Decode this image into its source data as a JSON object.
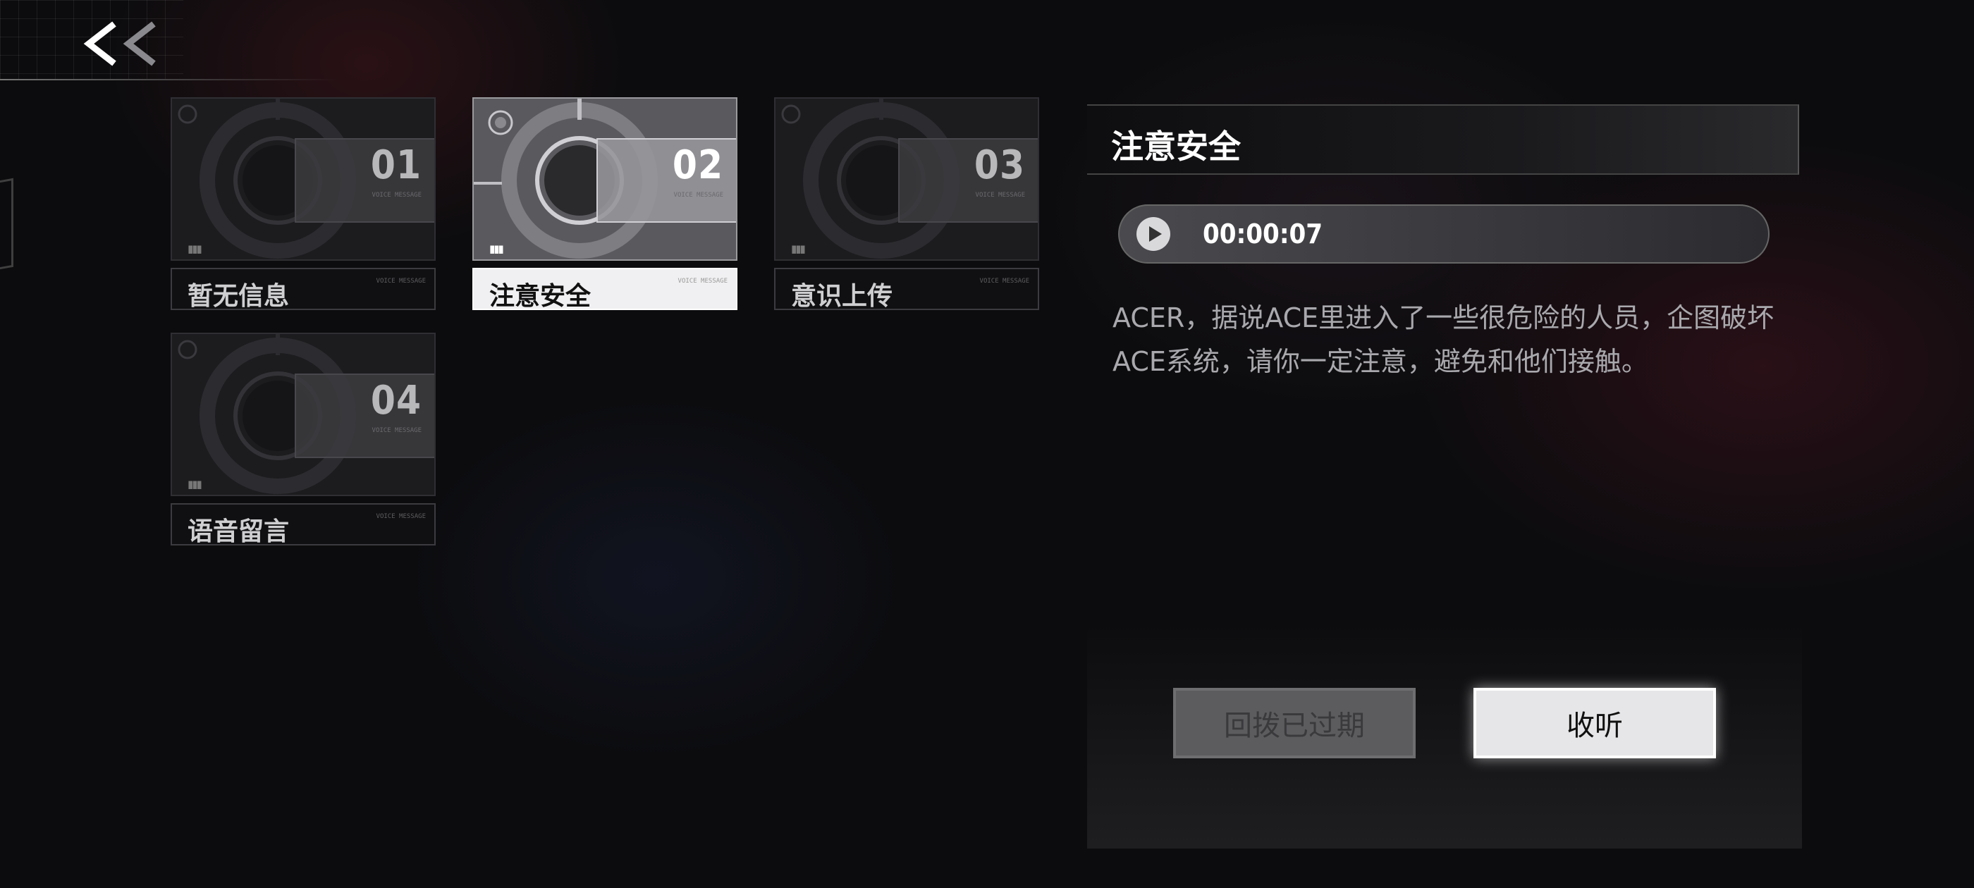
{
  "nav": {
    "back_icon": "double-chevron-left-icon"
  },
  "messages": [
    {
      "number": "01",
      "label": "暂无信息",
      "sublabel": "VOICE MESSAGE",
      "selected": false
    },
    {
      "number": "02",
      "label": "注意安全",
      "sublabel": "VOICE MESSAGE",
      "selected": true
    },
    {
      "number": "03",
      "label": "意识上传",
      "sublabel": "VOICE MESSAGE",
      "selected": false
    },
    {
      "number": "04",
      "label": "语音留言",
      "sublabel": "VOICE MESSAGE",
      "selected": false
    }
  ],
  "detail": {
    "title": "注意安全",
    "duration": "00:00:07",
    "text": "ACER，据说ACE里进入了一些很危险的人员，企图破坏ACE系统，请你一定注意，避免和他们接触。"
  },
  "buttons": {
    "callback": "回拨已过期",
    "listen": "收听"
  },
  "colors": {
    "selected_label_bg": "#f0f0f2",
    "background": "#0c0c0e",
    "listen_button": "#e6e6e8"
  }
}
